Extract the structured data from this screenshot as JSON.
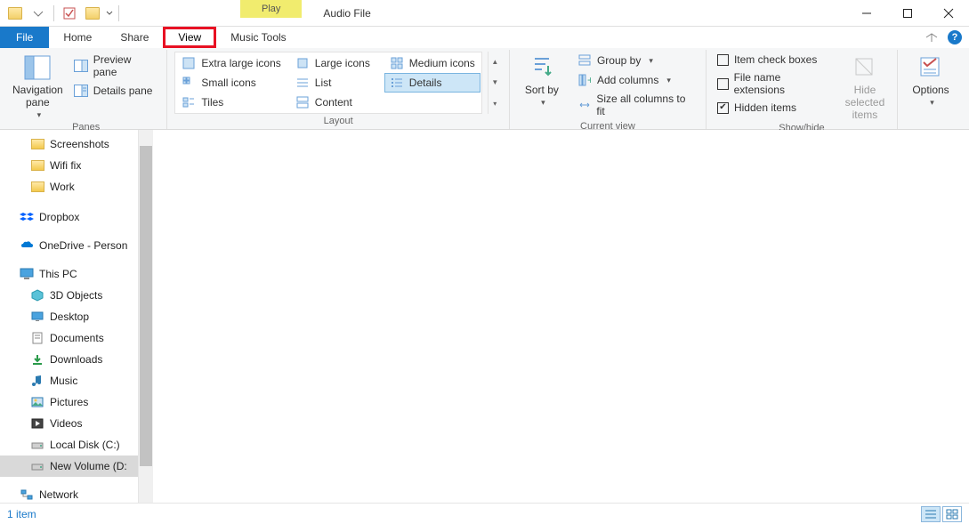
{
  "title": "Audio File",
  "context_tab": "Play",
  "tabs": {
    "file": "File",
    "home": "Home",
    "share": "Share",
    "view": "View",
    "music_tools": "Music Tools"
  },
  "ribbon": {
    "panes": {
      "label": "Panes",
      "navigation_pane": "Navigation pane",
      "preview_pane": "Preview pane",
      "details_pane": "Details pane"
    },
    "layout": {
      "label": "Layout",
      "extra_large": "Extra large icons",
      "large": "Large icons",
      "medium": "Medium icons",
      "small": "Small icons",
      "list": "List",
      "details": "Details",
      "tiles": "Tiles",
      "content": "Content"
    },
    "current_view": {
      "label": "Current view",
      "sort_by": "Sort by",
      "group_by": "Group by",
      "add_columns": "Add columns",
      "size_columns": "Size all columns to fit"
    },
    "show_hide": {
      "label": "Show/hide",
      "item_check": "Item check boxes",
      "file_ext": "File name extensions",
      "hidden": "Hidden items",
      "hide_selected": "Hide selected items"
    },
    "options": "Options"
  },
  "sidebar": {
    "screenshots": "Screenshots",
    "wifi_fix": "Wifi fix",
    "work": "Work",
    "dropbox": "Dropbox",
    "onedrive": "OneDrive - Person",
    "this_pc": "This PC",
    "objects_3d": "3D Objects",
    "desktop": "Desktop",
    "documents": "Documents",
    "downloads": "Downloads",
    "music": "Music",
    "pictures": "Pictures",
    "videos": "Videos",
    "local_disk": "Local Disk (C:)",
    "new_volume": "New Volume (D:",
    "network": "Network"
  },
  "status": {
    "count": "1 item"
  }
}
